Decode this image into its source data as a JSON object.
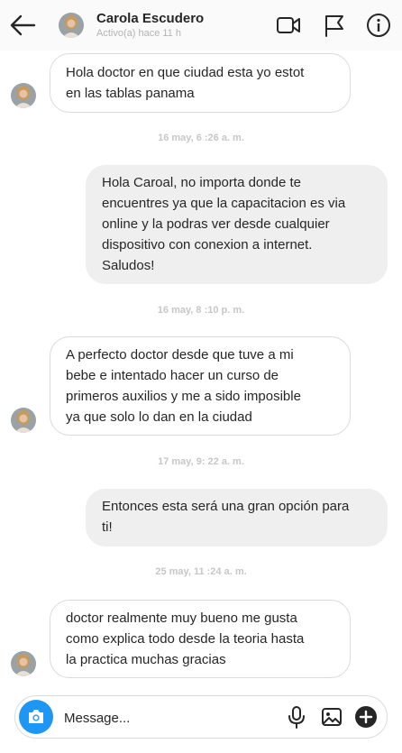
{
  "header": {
    "name": "Carola Escudero",
    "status": "Activo(a) hace 11 h",
    "icons": [
      "back-arrow-icon",
      "video-call-icon",
      "flag-icon",
      "info-icon"
    ]
  },
  "conversation": {
    "messages": [
      {
        "from": "contact",
        "lines": [
          " Hola doctor en que ciudad esta yo estot",
          "en las tablas panama"
        ]
      },
      {
        "timestamp": "16 may, 6 :26 a. m."
      },
      {
        "from": "me",
        "lines": [
          "Hola Caroal, no importa donde te",
          "encuentres ya que la capacitacion es via",
          "online y la podras ver desde cualquier",
          "dispositivo con conexion a internet.",
          "Saludos!"
        ]
      },
      {
        "timestamp": "16 may, 8 :10 p. m."
      },
      {
        "from": "contact",
        "lines": [
          "A perfecto doctor desde que tuve a mi",
          "bebe e intentado hacer un curso de",
          "primeros auxilios y me a sido imposible",
          "ya que solo lo dan en la ciudad"
        ]
      },
      {
        "timestamp": "17 may, 9: 22 a. m."
      },
      {
        "from": "me",
        "lines": [
          "Entonces esta será una gran opción para",
          "ti!"
        ]
      },
      {
        "timestamp": "25 may, 11 :24 a. m."
      },
      {
        "from": "contact",
        "lines": [
          "doctor realmente muy bueno me gusta",
          "como explica todo desde la teoria hasta",
          "la practica muchas gracias"
        ]
      }
    ]
  },
  "composer": {
    "placeholder": "Message...",
    "value": "",
    "icons": [
      "camera-icon",
      "microphone-icon",
      "image-icon",
      "plus-icon"
    ]
  },
  "colors": {
    "accent": "#1d97f3",
    "header_bg": "#fafafa",
    "outgoing_bubble": "#efefef",
    "incoming_border": "#dbdbdb",
    "timestamp": "#c7c7c7"
  }
}
